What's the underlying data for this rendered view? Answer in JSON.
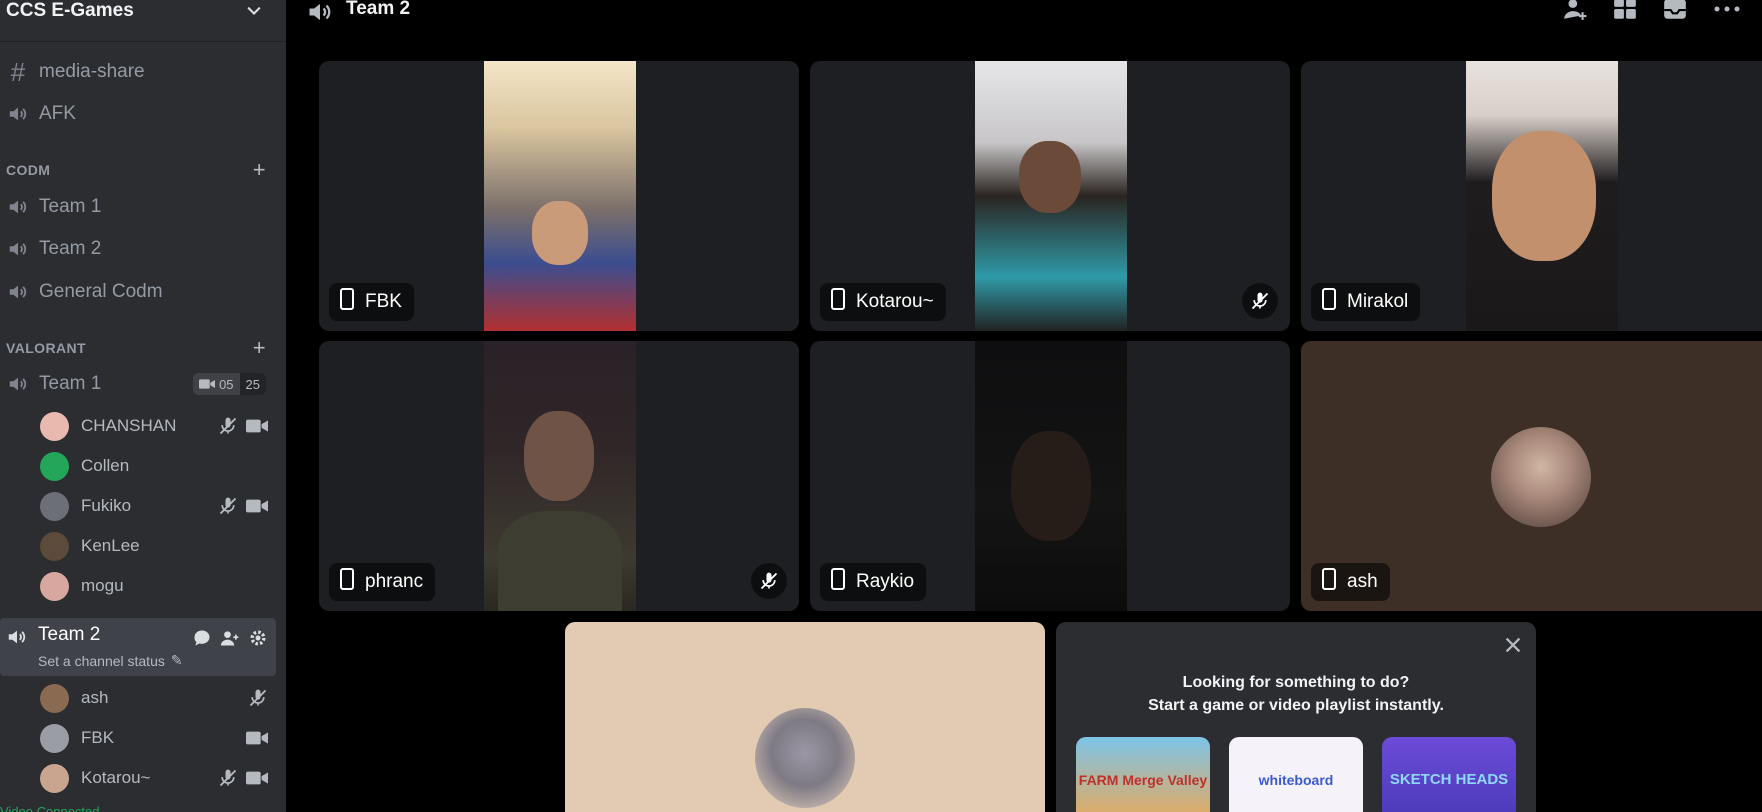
{
  "guild": {
    "name": "CCS E-Games"
  },
  "channels": {
    "media_share": "media-share",
    "afk": "AFK"
  },
  "categories": {
    "codm": "CODM",
    "valorant": "VALORANT"
  },
  "codm_channels": [
    "Team 1",
    "Team 2",
    "General Codm"
  ],
  "valorant_team1": {
    "label": "Team 1",
    "badge_left": "05",
    "badge_right": "25",
    "members": [
      {
        "name": "CHANSHAN",
        "muted": true,
        "video": true,
        "color": "#e9b9b0"
      },
      {
        "name": "Collen",
        "muted": false,
        "video": false,
        "color": "#23a55a"
      },
      {
        "name": "Fukiko",
        "muted": true,
        "video": true,
        "color": "#6d6f78"
      },
      {
        "name": "KenLee",
        "muted": false,
        "video": false,
        "color": "#5c4a3a"
      },
      {
        "name": "mogu",
        "muted": false,
        "video": false,
        "color": "#d7a7a0"
      }
    ]
  },
  "valorant_team2": {
    "label": "Team 2",
    "status": "Set a channel status",
    "members": [
      {
        "name": "ash",
        "muted": true,
        "video": false,
        "color": "#8a6a50"
      },
      {
        "name": "FBK",
        "muted": false,
        "video": true,
        "color": "#9a9da4"
      },
      {
        "name": "Kotarou~",
        "muted": true,
        "video": true,
        "color": "#c9a590"
      }
    ]
  },
  "bottom_label": "Video Connected",
  "topbar": {
    "title": "Team 2"
  },
  "tiles": [
    {
      "name": "FBK",
      "muted": false
    },
    {
      "name": "Kotarou~",
      "muted": true
    },
    {
      "name": "Mirakol",
      "muted": false
    },
    {
      "name": "phranc",
      "muted": true
    },
    {
      "name": "Raykio",
      "muted": false
    },
    {
      "name": "ash",
      "muted": true
    }
  ],
  "activity": {
    "line1": "Looking for something to do?",
    "line2": "Start a game or video playlist instantly.",
    "cards": [
      "FARM Merge Valley",
      "whiteboard",
      "SKETCH HEADS"
    ]
  },
  "colors": {
    "sidebar": "#2b2d31",
    "tile": "#1e1f22",
    "accent": "#5865f2",
    "online": "#23a55a"
  }
}
